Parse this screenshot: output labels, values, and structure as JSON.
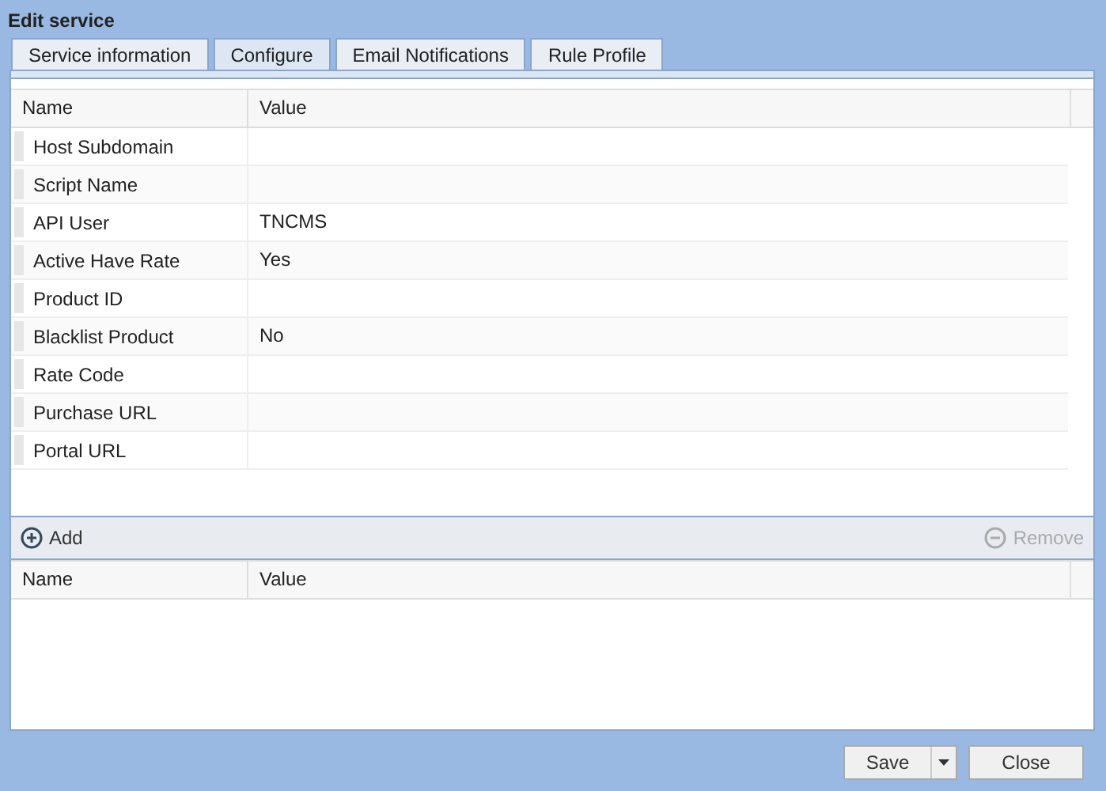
{
  "window": {
    "title": "Edit service"
  },
  "tabs": [
    {
      "label": "Service information",
      "selected": false
    },
    {
      "label": "Configure",
      "selected": true
    },
    {
      "label": "Email Notifications",
      "selected": false
    },
    {
      "label": "Rule Profile",
      "selected": false
    }
  ],
  "settings_table": {
    "columns": [
      "Name",
      "Value"
    ],
    "rows": [
      {
        "name": "Host Subdomain",
        "value": ""
      },
      {
        "name": "Script Name",
        "value": ""
      },
      {
        "name": "API User",
        "value": "TNCMS"
      },
      {
        "name": "Active Have Rate",
        "value": "Yes"
      },
      {
        "name": "Product ID",
        "value": ""
      },
      {
        "name": "Blacklist Product",
        "value": "No"
      },
      {
        "name": "Rate Code",
        "value": ""
      },
      {
        "name": "Purchase URL",
        "value": ""
      },
      {
        "name": "Portal URL",
        "value": ""
      }
    ]
  },
  "toolbar": {
    "add": {
      "label": "Add",
      "disabled": false
    },
    "remove": {
      "label": "Remove",
      "disabled": true
    }
  },
  "extra_table": {
    "columns": [
      "Name",
      "Value"
    ]
  },
  "buttons": {
    "save": "Save",
    "close": "Close"
  }
}
